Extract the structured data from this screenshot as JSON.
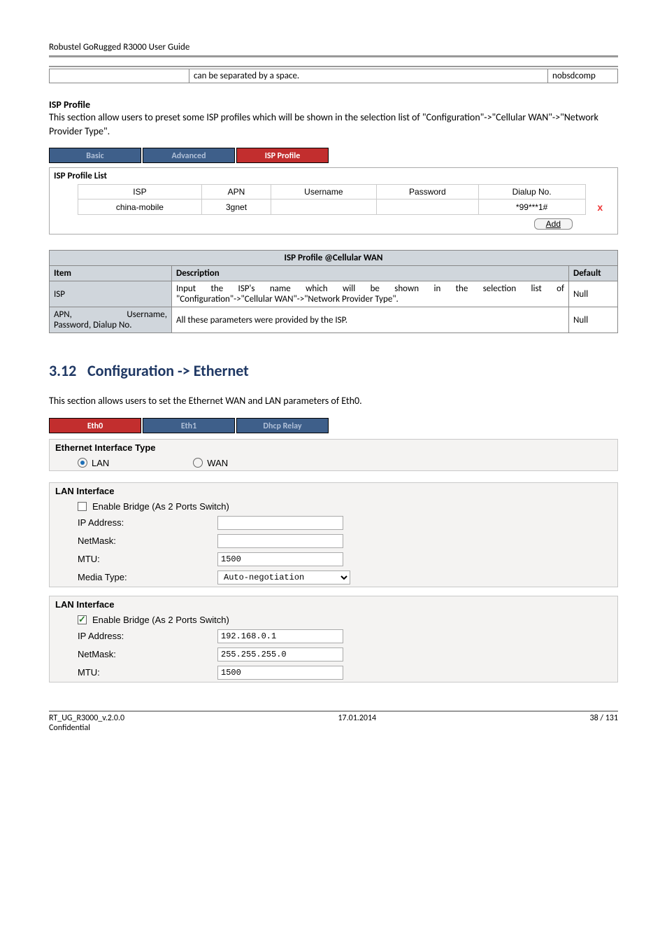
{
  "header": {
    "doc_title": "Robustel GoRugged R3000 User Guide"
  },
  "info_row": {
    "c2": "can be separated by a space.",
    "c3": "nobsdcomp"
  },
  "isp_profile_block": {
    "title": "ISP Profile",
    "text": "This section allow users to preset some ISP profiles which will be shown in the selection list of \"Configuration\"->\"Cellular WAN\"->\"Network Provider Type\"."
  },
  "tabs1": {
    "t1": "Basic",
    "t2": "Advanced",
    "t3": "ISP Profile"
  },
  "isp_list": {
    "title": "ISP Profile List",
    "cols": [
      "ISP",
      "APN",
      "Username",
      "Password",
      "Dialup No."
    ],
    "row": {
      "isp": "china-mobile",
      "apn": "3gnet",
      "user": "",
      "pass": "",
      "dial": "*99***1#"
    },
    "add": "Add"
  },
  "desc_table": {
    "caption": "ISP Profile @Cellular WAN",
    "hdr": {
      "item": "Item",
      "desc": "Description",
      "def": "Default"
    },
    "rows": [
      {
        "item": "ISP",
        "desc": "Input the ISP's name which will be shown in the selection list of \"Configuration\"->\"Cellular WAN\"->\"Network Provider Type\".",
        "def": "Null"
      },
      {
        "item": "APN, Username, Password, Dialup No.",
        "desc": "All these parameters were provided by the ISP.",
        "def": "Null"
      }
    ]
  },
  "h2": {
    "num": "3.12",
    "title": "Configuration -> Ethernet"
  },
  "eth_intro": "This section allows users to set the Ethernet WAN and LAN parameters of Eth0.",
  "tabs2": {
    "t1": "Eth0",
    "t2": "Eth1",
    "t3": "Dhcp Relay"
  },
  "eth_iface": {
    "title": "Ethernet Interface Type",
    "lan": "LAN",
    "wan": "WAN"
  },
  "lan1": {
    "title": "LAN Interface",
    "bridge": "Enable Bridge (As 2 Ports Switch)",
    "ip_label": "IP Address:",
    "mask_label": "NetMask:",
    "mtu_label": "MTU:",
    "mtu_val": "1500",
    "media_label": "Media Type:",
    "media_val": "Auto-negotiation"
  },
  "lan2": {
    "title": "LAN Interface",
    "bridge": "Enable Bridge (As 2 Ports Switch)",
    "ip_label": "IP Address:",
    "ip_val": "192.168.0.1",
    "mask_label": "NetMask:",
    "mask_val": "255.255.255.0",
    "mtu_label": "MTU:",
    "mtu_val": "1500"
  },
  "footer": {
    "left": "RT_UG_R3000_v.2.0.0",
    "center": "17.01.2014",
    "right": "38 / 131",
    "conf": "Confidential"
  }
}
